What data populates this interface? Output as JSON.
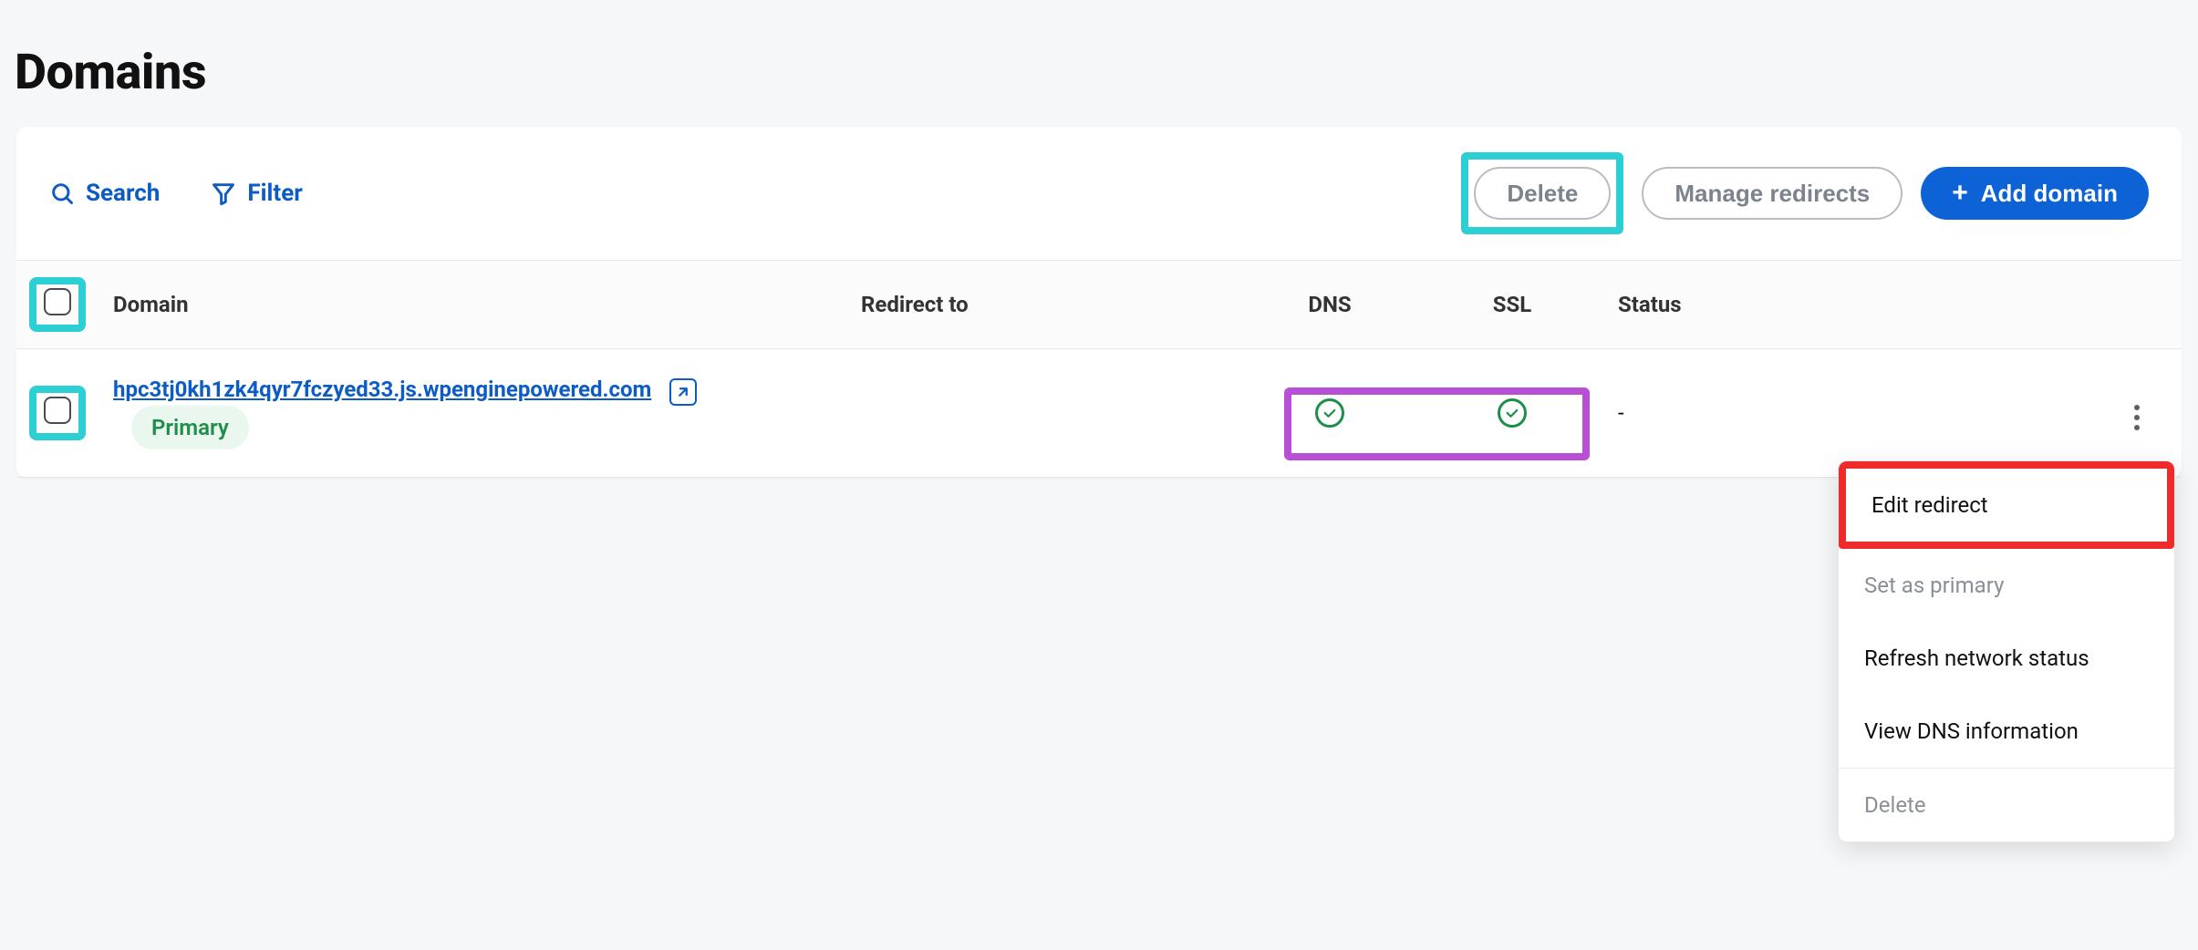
{
  "page": {
    "title": "Domains"
  },
  "toolbar": {
    "search_label": "Search",
    "filter_label": "Filter",
    "delete_label": "Delete",
    "manage_redirects_label": "Manage redirects",
    "add_domain_label": "Add domain"
  },
  "table": {
    "headers": {
      "domain": "Domain",
      "redirect_to": "Redirect to",
      "dns": "DNS",
      "ssl": "SSL",
      "status": "Status"
    },
    "rows": [
      {
        "domain": "hpc3tj0kh1zk4qyr7fczyed33.js.wpenginepowered.com",
        "badge": "Primary",
        "redirect_to": "",
        "dns_ok": true,
        "ssl_ok": true,
        "status": "-"
      }
    ]
  },
  "context_menu": {
    "items": [
      {
        "label": "Edit redirect",
        "disabled": false,
        "highlight": "red"
      },
      {
        "label": "Set as primary",
        "disabled": true
      },
      {
        "label": "Refresh network status",
        "disabled": false
      },
      {
        "label": "View DNS information",
        "disabled": false
      },
      {
        "label": "Delete",
        "disabled": true,
        "separator_before": true
      }
    ]
  }
}
